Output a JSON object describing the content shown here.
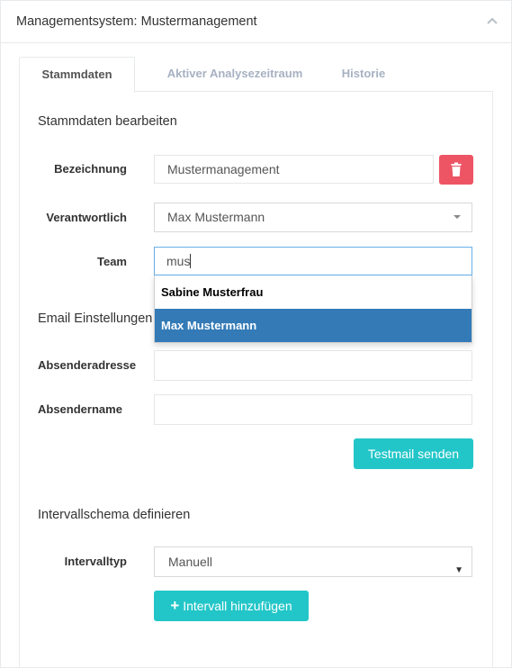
{
  "panel": {
    "title": "Managementsystem: Mustermanagement"
  },
  "tabs": [
    {
      "label": "Stammdaten",
      "active": true
    },
    {
      "label": "Aktiver Analysezeitraum",
      "active": false
    },
    {
      "label": "Historie",
      "active": false
    }
  ],
  "stammdaten": {
    "section_title": "Stammdaten bearbeiten",
    "bezeichnung_label": "Bezeichnung",
    "bezeichnung_value": "Mustermanagement",
    "verantwortlich_label": "Verantwortlich",
    "verantwortlich_value": "Max Mustermann",
    "team_label": "Team",
    "team_value": "mus",
    "team_suggestions": [
      "Sabine Musterfrau",
      "Max Mustermann"
    ]
  },
  "email": {
    "section_title": "Email Einstellungen",
    "absenderadresse_label": "Absenderadresse",
    "absenderadresse_value": "",
    "absendername_label": "Absendername",
    "absendername_value": "",
    "testmail_button": "Testmail senden"
  },
  "interval": {
    "section_title": "Intervallschema definieren",
    "intervalltyp_label": "Intervalltyp",
    "intervalltyp_value": "Manuell",
    "add_button_plus": "+",
    "add_button_label": "Intervall hinzufügen"
  },
  "colors": {
    "danger": "#ed5565",
    "primary": "#23c6c8",
    "selected": "#337ab7"
  }
}
